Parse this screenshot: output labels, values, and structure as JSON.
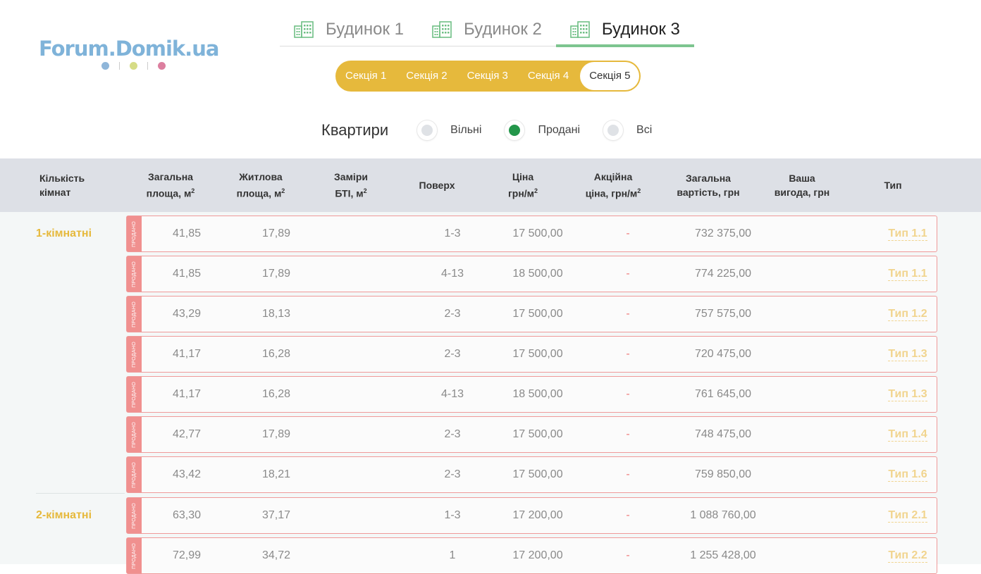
{
  "logo": {
    "text": "Forum.Domik.ua",
    "dot_colors": [
      "#8fb6d9",
      "#d6dc86",
      "#dc7f9f"
    ]
  },
  "houses": [
    {
      "label": "Будинок 1",
      "active": false
    },
    {
      "label": "Будинок 2",
      "active": false
    },
    {
      "label": "Будинок 3",
      "active": true
    }
  ],
  "sections": [
    {
      "label": "Секція 1",
      "active": false
    },
    {
      "label": "Секція 2",
      "active": false
    },
    {
      "label": "Секція 3",
      "active": false
    },
    {
      "label": "Секція 4",
      "active": false
    },
    {
      "label": "Секція 5",
      "active": true
    }
  ],
  "filter": {
    "title": "Квартири",
    "options": [
      {
        "label": "Вільні",
        "checked": false
      },
      {
        "label": "Продані",
        "checked": true
      },
      {
        "label": "Всі",
        "checked": false
      }
    ]
  },
  "table": {
    "headers": {
      "rooms": [
        "Кількість",
        "кімнат"
      ],
      "total_area": [
        "Загальна",
        "площа, м"
      ],
      "living_area": [
        "Житлова",
        "площа, м"
      ],
      "bti": [
        "Заміри",
        "БТІ, м"
      ],
      "floor": "Поверх",
      "price": [
        "Ціна",
        "грн/м"
      ],
      "promo": [
        "Акційна",
        "ціна, грн/м"
      ],
      "total_cost": [
        "Загальна",
        "вартість, грн"
      ],
      "benefit": [
        "Ваша",
        "вигода, грн"
      ],
      "type": "Тип",
      "sup": "2"
    },
    "sold_label": "ПРОДАНО",
    "groups": [
      {
        "label": "1-кімнатні"
      },
      {
        "label": "2-кімнатні"
      }
    ],
    "rows": [
      {
        "total_area": "41,85",
        "living_area": "17,89",
        "bti": "",
        "floor": "1-3",
        "price": "17 500,00",
        "promo": "-",
        "total_cost": "732 375,00",
        "benefit": "",
        "type": "Тип 1.1"
      },
      {
        "total_area": "41,85",
        "living_area": "17,89",
        "bti": "",
        "floor": "4-13",
        "price": "18 500,00",
        "promo": "-",
        "total_cost": "774 225,00",
        "benefit": "",
        "type": "Тип 1.1"
      },
      {
        "total_area": "43,29",
        "living_area": "18,13",
        "bti": "",
        "floor": "2-3",
        "price": "17 500,00",
        "promo": "-",
        "total_cost": "757 575,00",
        "benefit": "",
        "type": "Тип 1.2"
      },
      {
        "total_area": "41,17",
        "living_area": "16,28",
        "bti": "",
        "floor": "2-3",
        "price": "17 500,00",
        "promo": "-",
        "total_cost": "720 475,00",
        "benefit": "",
        "type": "Тип 1.3"
      },
      {
        "total_area": "41,17",
        "living_area": "16,28",
        "bti": "",
        "floor": "4-13",
        "price": "18 500,00",
        "promo": "-",
        "total_cost": "761 645,00",
        "benefit": "",
        "type": "Тип 1.3"
      },
      {
        "total_area": "42,77",
        "living_area": "17,89",
        "bti": "",
        "floor": "2-3",
        "price": "17 500,00",
        "promo": "-",
        "total_cost": "748 475,00",
        "benefit": "",
        "type": "Тип 1.4"
      },
      {
        "total_area": "43,42",
        "living_area": "18,21",
        "bti": "",
        "floor": "2-3",
        "price": "17 500,00",
        "promo": "-",
        "total_cost": "759 850,00",
        "benefit": "",
        "type": "Тип 1.6"
      },
      {
        "total_area": "63,30",
        "living_area": "37,17",
        "bti": "",
        "floor": "1-3",
        "price": "17 200,00",
        "promo": "-",
        "total_cost": "1 088 760,00",
        "benefit": "",
        "type": "Тип 2.1"
      },
      {
        "total_area": "72,99",
        "living_area": "34,72",
        "bti": "",
        "floor": "1",
        "price": "17 200,00",
        "promo": "-",
        "total_cost": "1 255 428,00",
        "benefit": "",
        "type": "Тип 2.2"
      }
    ]
  }
}
